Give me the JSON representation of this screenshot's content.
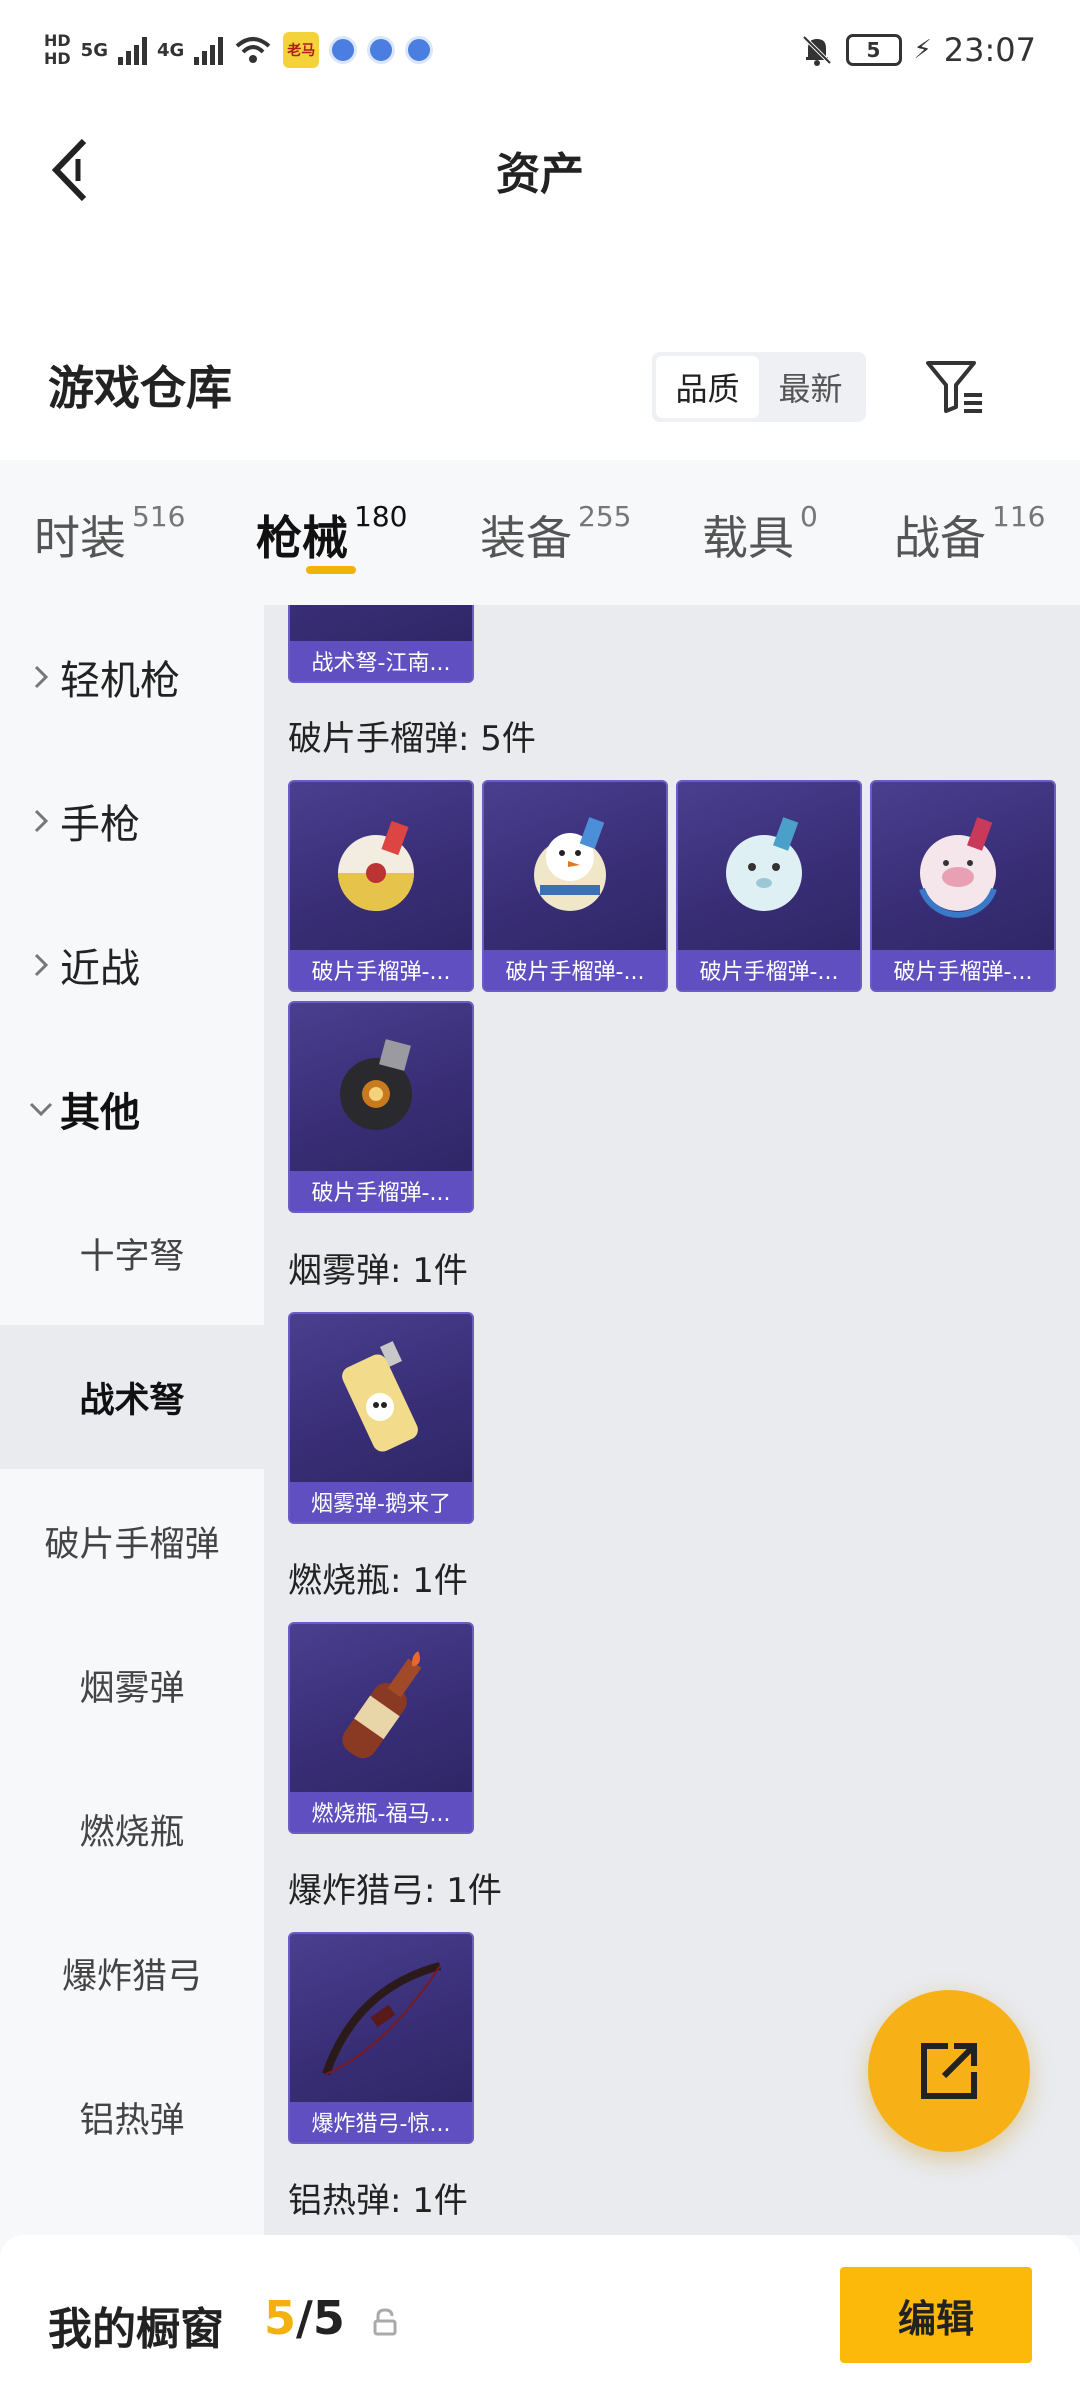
{
  "status_bar": {
    "time": "23:07",
    "battery": "5",
    "network": [
      "5G",
      "4G"
    ],
    "left_badge": "老马"
  },
  "header": {
    "title": "资产",
    "section_title": "游戏仓库",
    "sort_options": [
      "品质",
      "最新"
    ],
    "sort_active": "品质"
  },
  "tabs": [
    {
      "label": "时装",
      "count": "516"
    },
    {
      "label": "枪械",
      "count": "180"
    },
    {
      "label": "装备",
      "count": "255"
    },
    {
      "label": "载具",
      "count": "0"
    },
    {
      "label": "战备",
      "count": "116"
    }
  ],
  "active_tab": "枪械",
  "sidebar": {
    "parents": [
      {
        "label": "轻机枪"
      },
      {
        "label": "手枪"
      },
      {
        "label": "近战"
      },
      {
        "label": "其他"
      }
    ],
    "children": [
      {
        "label": "十字弩"
      },
      {
        "label": "战术弩"
      },
      {
        "label": "破片手榴弹"
      },
      {
        "label": "烟雾弹"
      },
      {
        "label": "燃烧瓶"
      },
      {
        "label": "爆炸猎弓"
      },
      {
        "label": "铝热弹"
      }
    ],
    "selected_child": "战术弩"
  },
  "content": {
    "top_item": {
      "label": "战术弩-江南..."
    },
    "groups": [
      {
        "title": "破片手榴弹: 5件",
        "items": [
          {
            "label": "破片手榴弹-...",
            "icon": "grenade-icon"
          },
          {
            "label": "破片手榴弹-...",
            "icon": "grenade-icon"
          },
          {
            "label": "破片手榴弹-...",
            "icon": "grenade-icon"
          },
          {
            "label": "破片手榴弹-...",
            "icon": "grenade-icon"
          },
          {
            "label": "破片手榴弹-...",
            "icon": "grenade-icon"
          }
        ]
      },
      {
        "title": "烟雾弹: 1件",
        "items": [
          {
            "label": "烟雾弹-鹅来了",
            "icon": "smoke-grenade-icon"
          }
        ]
      },
      {
        "title": "燃烧瓶: 1件",
        "items": [
          {
            "label": "燃烧瓶-福马...",
            "icon": "molotov-icon"
          }
        ]
      },
      {
        "title": "爆炸猎弓: 1件",
        "items": [
          {
            "label": "爆炸猎弓-惊...",
            "icon": "bow-icon"
          }
        ]
      },
      {
        "title": "铝热弹: 1件",
        "items": []
      }
    ]
  },
  "bottom_bar": {
    "title": "我的橱窗",
    "count_current": "5",
    "count_total": "5",
    "edit_label": "编辑"
  },
  "colors": {
    "accent": "#f2b10c",
    "card_bg": "#3a2f78",
    "card_label_bg": "#5f4fc0"
  }
}
